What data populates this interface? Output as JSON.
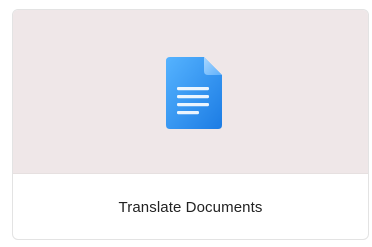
{
  "card": {
    "label": "Translate Documents",
    "icon": "document-icon",
    "colors": {
      "preview_background": "#efe7e8",
      "icon_blue_light": "#4aa8ff",
      "icon_blue_dark": "#1f7fe6",
      "label_text": "#222222"
    }
  }
}
